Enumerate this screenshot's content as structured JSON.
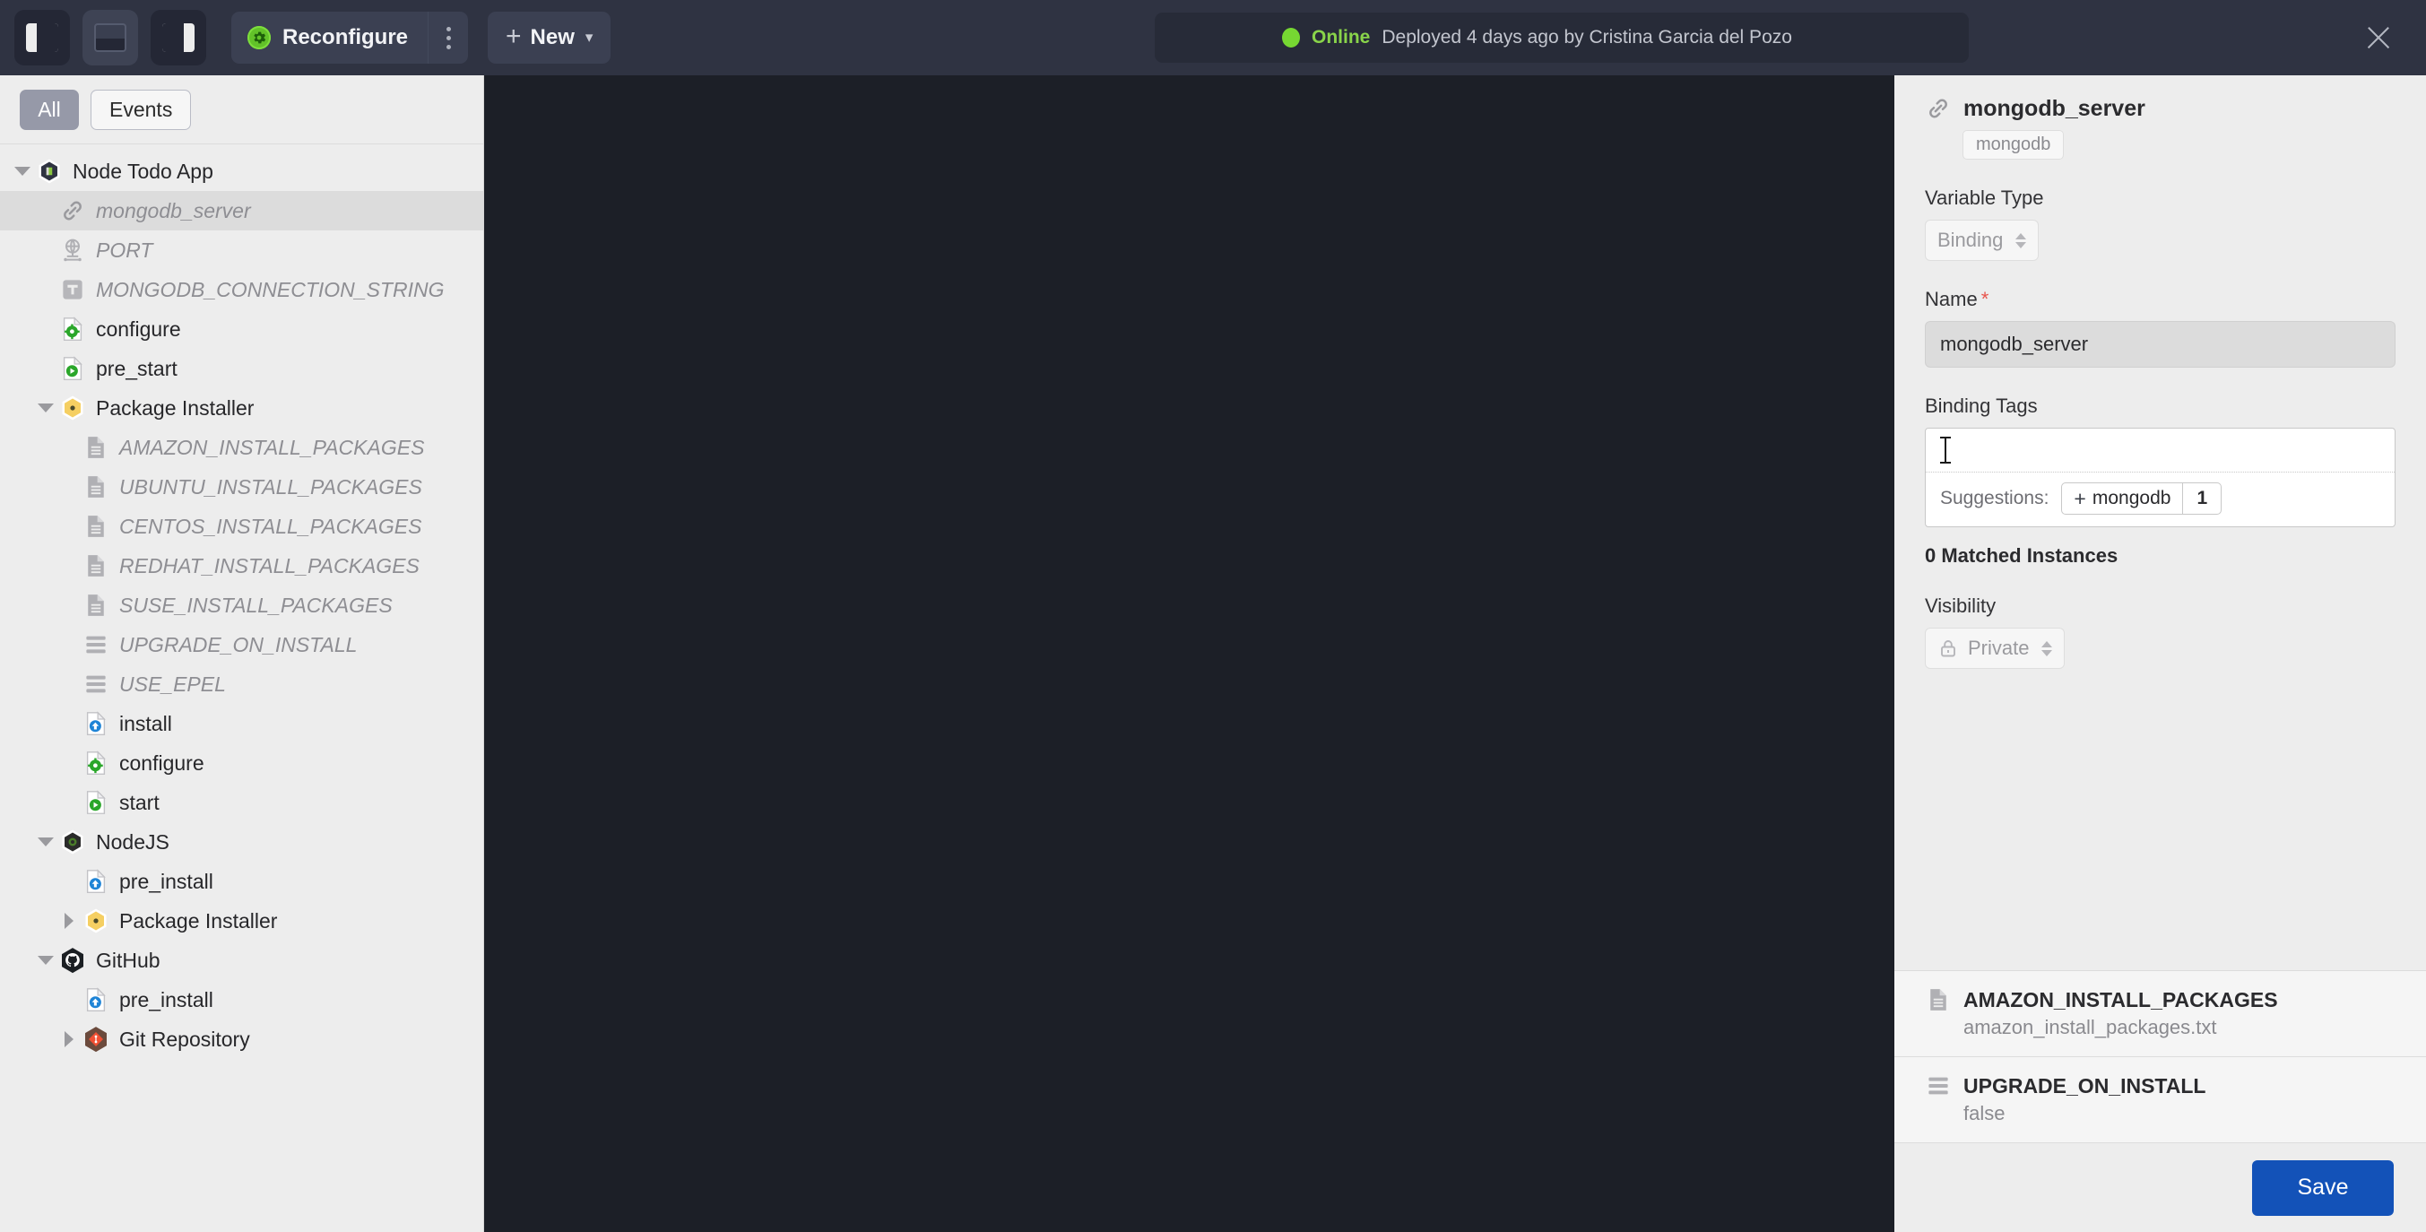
{
  "toolbar": {
    "panel_toggles": [
      {
        "name": "toggle-left-panel",
        "state": "off"
      },
      {
        "name": "toggle-bottom-panel",
        "state": "on"
      },
      {
        "name": "toggle-right-panel",
        "state": "off"
      }
    ],
    "reconfigure_label": "Reconfigure",
    "kebab_name": "more-options",
    "new_label": "New",
    "plus_glyph": "+",
    "chevron_glyph": "⌄",
    "status": {
      "state": "Online",
      "detail": "Deployed 4 days ago by Cristina Garcia del Pozo",
      "dot_color": "#76d832",
      "text_color": "#89d44a"
    },
    "close_label": "Close"
  },
  "sidebar": {
    "filters": [
      {
        "label": "All",
        "active": true
      },
      {
        "label": "Events",
        "active": false
      }
    ],
    "tree": [
      {
        "label": "Node Todo App",
        "depth": 0,
        "caret": "down",
        "icon": "app-hex-icon",
        "muted": false,
        "selected": false
      },
      {
        "label": "mongodb_server",
        "depth": 1,
        "caret": "none",
        "icon": "link-icon",
        "muted": true,
        "selected": true
      },
      {
        "label": "PORT",
        "depth": 1,
        "caret": "none",
        "icon": "globe-port-icon",
        "muted": true,
        "selected": false
      },
      {
        "label": "MONGODB_CONNECTION_STRING",
        "depth": 1,
        "caret": "none",
        "icon": "text-var-icon",
        "muted": true,
        "selected": false
      },
      {
        "label": "configure",
        "depth": 1,
        "caret": "none",
        "icon": "script-gear-icon",
        "muted": false,
        "selected": false
      },
      {
        "label": "pre_start",
        "depth": 1,
        "caret": "none",
        "icon": "script-play-icon",
        "muted": false,
        "selected": false
      },
      {
        "label": "Package Installer",
        "depth": 1,
        "caret": "down",
        "icon": "package-hex-icon",
        "muted": false,
        "selected": false
      },
      {
        "label": "AMAZON_INSTALL_PACKAGES",
        "depth": 2,
        "caret": "none",
        "icon": "file-text-icon",
        "muted": true,
        "selected": false
      },
      {
        "label": "UBUNTU_INSTALL_PACKAGES",
        "depth": 2,
        "caret": "none",
        "icon": "file-text-icon",
        "muted": true,
        "selected": false
      },
      {
        "label": "CENTOS_INSTALL_PACKAGES",
        "depth": 2,
        "caret": "none",
        "icon": "file-text-icon",
        "muted": true,
        "selected": false
      },
      {
        "label": "REDHAT_INSTALL_PACKAGES",
        "depth": 2,
        "caret": "none",
        "icon": "file-text-icon",
        "muted": true,
        "selected": false
      },
      {
        "label": "SUSE_INSTALL_PACKAGES",
        "depth": 2,
        "caret": "none",
        "icon": "file-text-icon",
        "muted": true,
        "selected": false
      },
      {
        "label": "UPGRADE_ON_INSTALL",
        "depth": 2,
        "caret": "none",
        "icon": "list-lines-icon",
        "muted": true,
        "selected": false
      },
      {
        "label": "USE_EPEL",
        "depth": 2,
        "caret": "none",
        "icon": "list-lines-icon",
        "muted": true,
        "selected": false
      },
      {
        "label": "install",
        "depth": 2,
        "caret": "none",
        "icon": "script-install-icon",
        "muted": false,
        "selected": false
      },
      {
        "label": "configure",
        "depth": 2,
        "caret": "none",
        "icon": "script-gear-icon",
        "muted": false,
        "selected": false
      },
      {
        "label": "start",
        "depth": 2,
        "caret": "none",
        "icon": "script-play-icon",
        "muted": false,
        "selected": false
      },
      {
        "label": "NodeJS",
        "depth": 1,
        "caret": "down",
        "icon": "nodejs-hex-icon",
        "muted": false,
        "selected": false
      },
      {
        "label": "pre_install",
        "depth": 2,
        "caret": "none",
        "icon": "script-install-icon",
        "muted": false,
        "selected": false
      },
      {
        "label": "Package Installer",
        "depth": 2,
        "caret": "right",
        "icon": "package-hex-icon",
        "muted": false,
        "selected": false
      },
      {
        "label": "GitHub",
        "depth": 1,
        "caret": "down",
        "icon": "github-hex-icon",
        "muted": false,
        "selected": false
      },
      {
        "label": "pre_install",
        "depth": 2,
        "caret": "none",
        "icon": "script-install-icon",
        "muted": false,
        "selected": false
      },
      {
        "label": "Git Repository",
        "depth": 2,
        "caret": "right",
        "icon": "git-hex-icon",
        "muted": false,
        "selected": false
      }
    ]
  },
  "detail": {
    "title": "mongodb_server",
    "title_icon": "link-icon",
    "tag": "mongodb",
    "variable_type_label": "Variable Type",
    "variable_type_value": "Binding",
    "name_label": "Name",
    "name_required": "*",
    "name_value": "mongodb_server",
    "binding_tags_label": "Binding Tags",
    "binding_tags_value": "",
    "suggestions_label": "Suggestions:",
    "suggestion_chip": {
      "plus": "+",
      "label": "mongodb",
      "count": "1"
    },
    "matched_instances": "0 Matched Instances",
    "visibility_label": "Visibility",
    "visibility_value": "Private",
    "items": [
      {
        "name": "AMAZON_INSTALL_PACKAGES",
        "sub": "amazon_install_packages.txt",
        "icon": "file-text-icon"
      },
      {
        "name": "UPGRADE_ON_INSTALL",
        "sub": "false",
        "icon": "list-lines-icon"
      }
    ],
    "save_label": "Save",
    "save_color": "#1352b8"
  }
}
